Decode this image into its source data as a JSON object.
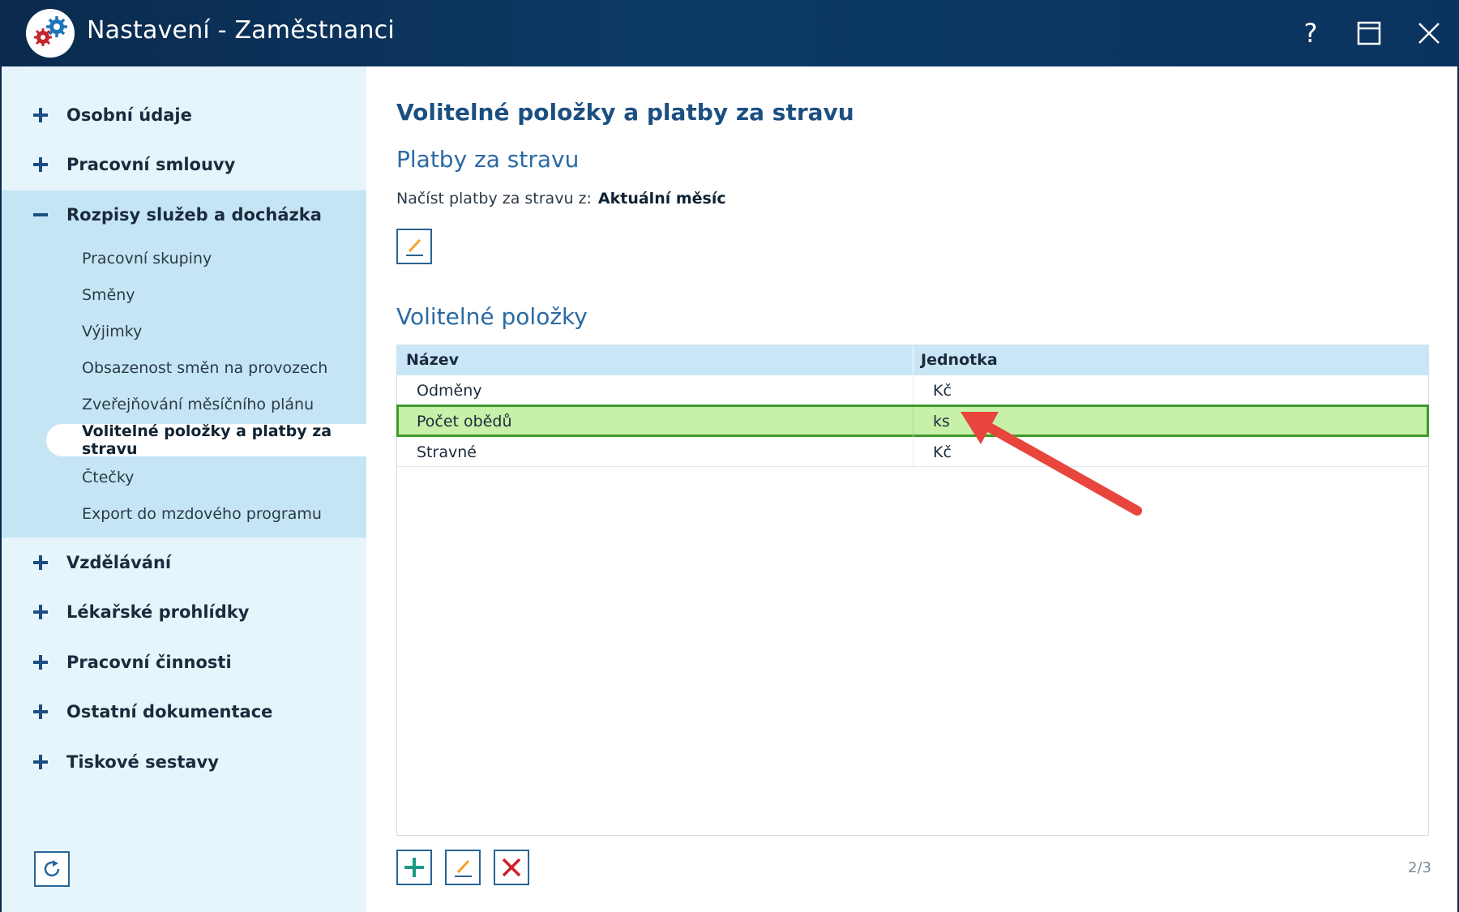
{
  "window": {
    "title": "Nastavení - Zaměstnanci",
    "help_label": "?"
  },
  "sidebar": {
    "items": [
      {
        "label": "Osobní údaje",
        "state": "collapsed"
      },
      {
        "label": "Pracovní smlouvy",
        "state": "collapsed"
      },
      {
        "label": "Rozpisy služeb a docházka",
        "state": "expanded"
      },
      {
        "label": "Vzdělávání",
        "state": "collapsed"
      },
      {
        "label": "Lékařské prohlídky",
        "state": "collapsed"
      },
      {
        "label": "Pracovní činnosti",
        "state": "collapsed"
      },
      {
        "label": "Ostatní dokumentace",
        "state": "collapsed"
      },
      {
        "label": "Tiskové sestavy",
        "state": "collapsed"
      }
    ],
    "subitems": [
      {
        "label": "Pracovní skupiny"
      },
      {
        "label": "Směny"
      },
      {
        "label": "Výjimky"
      },
      {
        "label": "Obsazenost směn na provozech"
      },
      {
        "label": "Zveřejňování měsíčního plánu"
      },
      {
        "label": "Volitelné položky a platby za stravu",
        "active": true
      },
      {
        "label": "Čtečky"
      },
      {
        "label": "Export do mzdového programu"
      }
    ]
  },
  "main": {
    "page_title": "Volitelné položky a platby za stravu",
    "meal_section": {
      "title": "Platby za stravu",
      "load_label": "Načíst platby za stravu z:",
      "load_value": "Aktuální měsíc"
    },
    "optional_section": {
      "title": "Volitelné položky",
      "columns": [
        "Název",
        "Jednotka"
      ],
      "rows": [
        {
          "name": "Odměny",
          "unit": "Kč",
          "selected": false
        },
        {
          "name": "Počet obědů",
          "unit": "ks",
          "selected": true
        },
        {
          "name": "Stravné",
          "unit": "Kč",
          "selected": false
        }
      ]
    },
    "counter": "2/3"
  },
  "colors": {
    "titlebar": "#0d3a66",
    "sidebar_bg": "#e6f4fb",
    "expanded_bg": "#c5e5f5",
    "selected_row": "#c7f0a8",
    "selected_border": "#3d9a2c",
    "add_icon": "#1d9a86",
    "delete_icon": "#d0202a",
    "arrow": "#e8453c"
  },
  "icons": {
    "app": "gears-icon",
    "help": "help-icon",
    "maximize": "maximize-icon",
    "close": "close-icon",
    "expand": "plus-icon",
    "collapse": "minus-icon",
    "edit": "pencil-icon",
    "add": "add-icon",
    "delete": "delete-icon",
    "refresh": "refresh-icon"
  }
}
